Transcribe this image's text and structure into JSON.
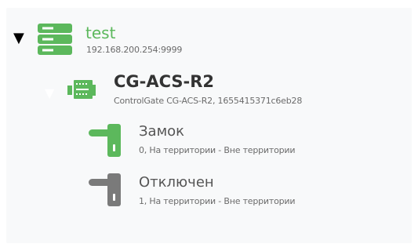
{
  "colors": {
    "accent_green": "#5cb85c",
    "muted_gray": "#7a7a7a",
    "text_dark": "#333333",
    "text_sub": "#6b6b6b"
  },
  "tree": {
    "server": {
      "name": "test",
      "address": "192.168.200.254:9999",
      "icon": "server-icon",
      "expanded": true
    },
    "controller": {
      "name": "CG-ACS-R2",
      "details": "ControlGate CG-ACS-R2, 1655415371c6eb28",
      "icon": "network-card-icon",
      "expanded": true
    },
    "locks": [
      {
        "name": "Замок",
        "details": "0, На территории - Вне территории",
        "icon": "door-handle-icon",
        "state_color": "#5cb85c"
      },
      {
        "name": "Отключен",
        "details": "1, На территории - Вне территории",
        "icon": "door-handle-icon",
        "state_color": "#7a7a7a"
      }
    ]
  }
}
